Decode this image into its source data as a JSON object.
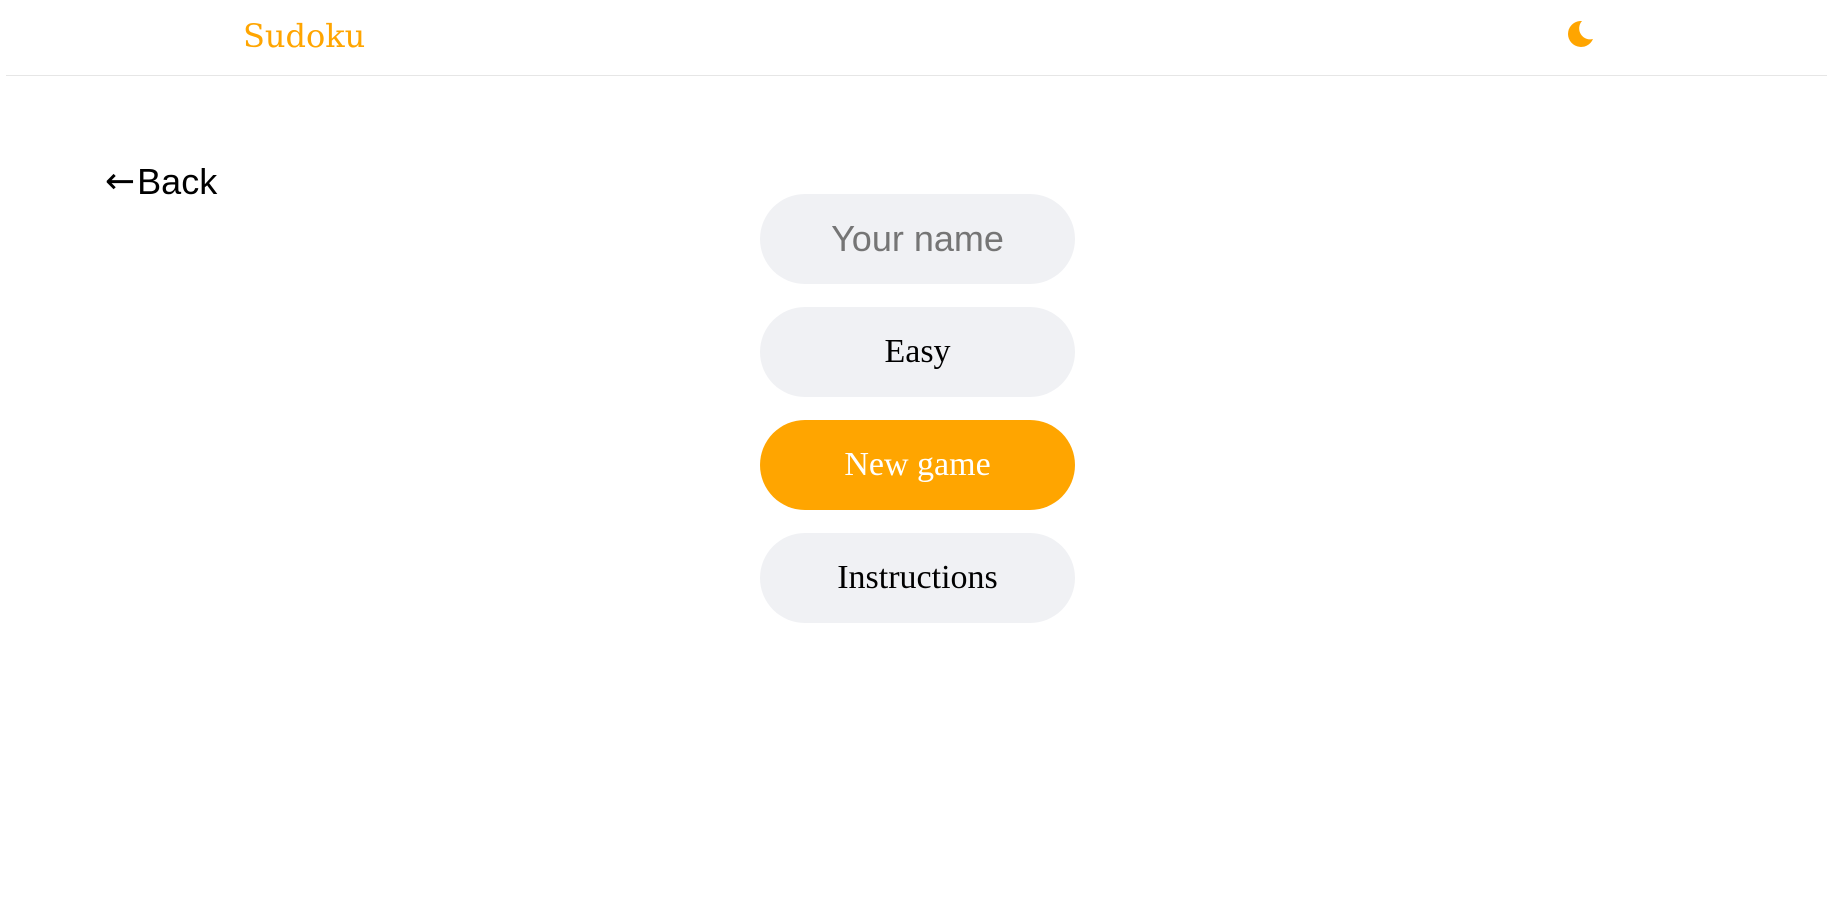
{
  "header": {
    "brand": "Sudoku",
    "theme_toggle_icon": "moon-icon",
    "accent_color": "#ffa500"
  },
  "nav": {
    "back_arrow": "←",
    "back_label": "Back"
  },
  "form": {
    "name_placeholder": "Your name",
    "name_value": "",
    "difficulty_value": "Easy",
    "new_game_label": "New game",
    "instructions_label": "Instructions"
  }
}
